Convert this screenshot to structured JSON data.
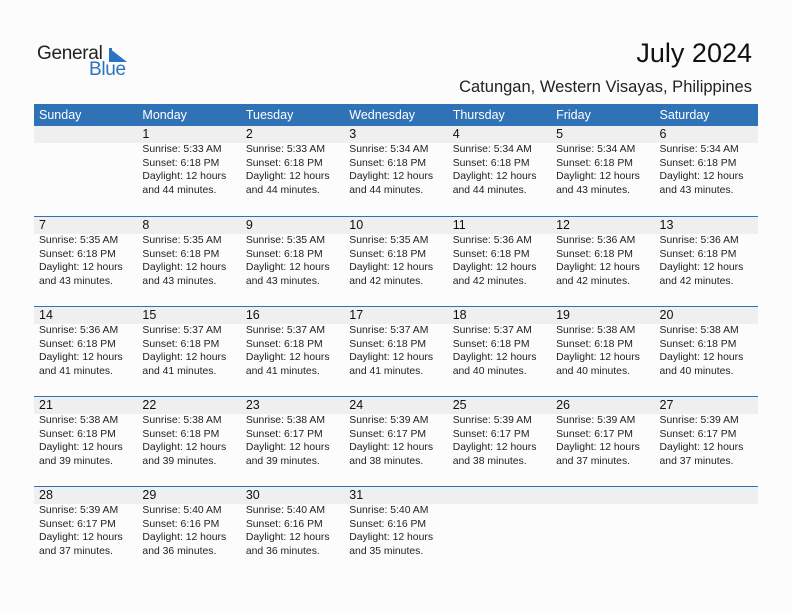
{
  "logo": {
    "line1": "General",
    "line2": "Blue",
    "icon": "triangle-flag-icon",
    "color": "#2a74c0"
  },
  "header": {
    "title": "July 2024",
    "location": "Catungan, Western Visayas, Philippines"
  },
  "colors": {
    "header_bg": "#2f72b6",
    "band_bg": "#efefef"
  },
  "weekdays": [
    "Sunday",
    "Monday",
    "Tuesday",
    "Wednesday",
    "Thursday",
    "Friday",
    "Saturday"
  ],
  "weeks": [
    [
      null,
      {
        "day": "1",
        "sunrise": "Sunrise: 5:33 AM",
        "sunset": "Sunset: 6:18 PM",
        "daylight1": "Daylight: 12 hours",
        "daylight2": "and 44 minutes."
      },
      {
        "day": "2",
        "sunrise": "Sunrise: 5:33 AM",
        "sunset": "Sunset: 6:18 PM",
        "daylight1": "Daylight: 12 hours",
        "daylight2": "and 44 minutes."
      },
      {
        "day": "3",
        "sunrise": "Sunrise: 5:34 AM",
        "sunset": "Sunset: 6:18 PM",
        "daylight1": "Daylight: 12 hours",
        "daylight2": "and 44 minutes."
      },
      {
        "day": "4",
        "sunrise": "Sunrise: 5:34 AM",
        "sunset": "Sunset: 6:18 PM",
        "daylight1": "Daylight: 12 hours",
        "daylight2": "and 44 minutes."
      },
      {
        "day": "5",
        "sunrise": "Sunrise: 5:34 AM",
        "sunset": "Sunset: 6:18 PM",
        "daylight1": "Daylight: 12 hours",
        "daylight2": "and 43 minutes."
      },
      {
        "day": "6",
        "sunrise": "Sunrise: 5:34 AM",
        "sunset": "Sunset: 6:18 PM",
        "daylight1": "Daylight: 12 hours",
        "daylight2": "and 43 minutes."
      }
    ],
    [
      {
        "day": "7",
        "sunrise": "Sunrise: 5:35 AM",
        "sunset": "Sunset: 6:18 PM",
        "daylight1": "Daylight: 12 hours",
        "daylight2": "and 43 minutes."
      },
      {
        "day": "8",
        "sunrise": "Sunrise: 5:35 AM",
        "sunset": "Sunset: 6:18 PM",
        "daylight1": "Daylight: 12 hours",
        "daylight2": "and 43 minutes."
      },
      {
        "day": "9",
        "sunrise": "Sunrise: 5:35 AM",
        "sunset": "Sunset: 6:18 PM",
        "daylight1": "Daylight: 12 hours",
        "daylight2": "and 43 minutes."
      },
      {
        "day": "10",
        "sunrise": "Sunrise: 5:35 AM",
        "sunset": "Sunset: 6:18 PM",
        "daylight1": "Daylight: 12 hours",
        "daylight2": "and 42 minutes."
      },
      {
        "day": "11",
        "sunrise": "Sunrise: 5:36 AM",
        "sunset": "Sunset: 6:18 PM",
        "daylight1": "Daylight: 12 hours",
        "daylight2": "and 42 minutes."
      },
      {
        "day": "12",
        "sunrise": "Sunrise: 5:36 AM",
        "sunset": "Sunset: 6:18 PM",
        "daylight1": "Daylight: 12 hours",
        "daylight2": "and 42 minutes."
      },
      {
        "day": "13",
        "sunrise": "Sunrise: 5:36 AM",
        "sunset": "Sunset: 6:18 PM",
        "daylight1": "Daylight: 12 hours",
        "daylight2": "and 42 minutes."
      }
    ],
    [
      {
        "day": "14",
        "sunrise": "Sunrise: 5:36 AM",
        "sunset": "Sunset: 6:18 PM",
        "daylight1": "Daylight: 12 hours",
        "daylight2": "and 41 minutes."
      },
      {
        "day": "15",
        "sunrise": "Sunrise: 5:37 AM",
        "sunset": "Sunset: 6:18 PM",
        "daylight1": "Daylight: 12 hours",
        "daylight2": "and 41 minutes."
      },
      {
        "day": "16",
        "sunrise": "Sunrise: 5:37 AM",
        "sunset": "Sunset: 6:18 PM",
        "daylight1": "Daylight: 12 hours",
        "daylight2": "and 41 minutes."
      },
      {
        "day": "17",
        "sunrise": "Sunrise: 5:37 AM",
        "sunset": "Sunset: 6:18 PM",
        "daylight1": "Daylight: 12 hours",
        "daylight2": "and 41 minutes."
      },
      {
        "day": "18",
        "sunrise": "Sunrise: 5:37 AM",
        "sunset": "Sunset: 6:18 PM",
        "daylight1": "Daylight: 12 hours",
        "daylight2": "and 40 minutes."
      },
      {
        "day": "19",
        "sunrise": "Sunrise: 5:38 AM",
        "sunset": "Sunset: 6:18 PM",
        "daylight1": "Daylight: 12 hours",
        "daylight2": "and 40 minutes."
      },
      {
        "day": "20",
        "sunrise": "Sunrise: 5:38 AM",
        "sunset": "Sunset: 6:18 PM",
        "daylight1": "Daylight: 12 hours",
        "daylight2": "and 40 minutes."
      }
    ],
    [
      {
        "day": "21",
        "sunrise": "Sunrise: 5:38 AM",
        "sunset": "Sunset: 6:18 PM",
        "daylight1": "Daylight: 12 hours",
        "daylight2": "and 39 minutes."
      },
      {
        "day": "22",
        "sunrise": "Sunrise: 5:38 AM",
        "sunset": "Sunset: 6:18 PM",
        "daylight1": "Daylight: 12 hours",
        "daylight2": "and 39 minutes."
      },
      {
        "day": "23",
        "sunrise": "Sunrise: 5:38 AM",
        "sunset": "Sunset: 6:17 PM",
        "daylight1": "Daylight: 12 hours",
        "daylight2": "and 39 minutes."
      },
      {
        "day": "24",
        "sunrise": "Sunrise: 5:39 AM",
        "sunset": "Sunset: 6:17 PM",
        "daylight1": "Daylight: 12 hours",
        "daylight2": "and 38 minutes."
      },
      {
        "day": "25",
        "sunrise": "Sunrise: 5:39 AM",
        "sunset": "Sunset: 6:17 PM",
        "daylight1": "Daylight: 12 hours",
        "daylight2": "and 38 minutes."
      },
      {
        "day": "26",
        "sunrise": "Sunrise: 5:39 AM",
        "sunset": "Sunset: 6:17 PM",
        "daylight1": "Daylight: 12 hours",
        "daylight2": "and 37 minutes."
      },
      {
        "day": "27",
        "sunrise": "Sunrise: 5:39 AM",
        "sunset": "Sunset: 6:17 PM",
        "daylight1": "Daylight: 12 hours",
        "daylight2": "and 37 minutes."
      }
    ],
    [
      {
        "day": "28",
        "sunrise": "Sunrise: 5:39 AM",
        "sunset": "Sunset: 6:17 PM",
        "daylight1": "Daylight: 12 hours",
        "daylight2": "and 37 minutes."
      },
      {
        "day": "29",
        "sunrise": "Sunrise: 5:40 AM",
        "sunset": "Sunset: 6:16 PM",
        "daylight1": "Daylight: 12 hours",
        "daylight2": "and 36 minutes."
      },
      {
        "day": "30",
        "sunrise": "Sunrise: 5:40 AM",
        "sunset": "Sunset: 6:16 PM",
        "daylight1": "Daylight: 12 hours",
        "daylight2": "and 36 minutes."
      },
      {
        "day": "31",
        "sunrise": "Sunrise: 5:40 AM",
        "sunset": "Sunset: 6:16 PM",
        "daylight1": "Daylight: 12 hours",
        "daylight2": "and 35 minutes."
      },
      null,
      null,
      null
    ]
  ]
}
